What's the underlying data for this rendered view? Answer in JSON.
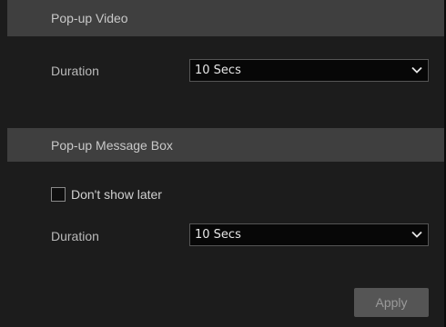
{
  "popup_video": {
    "title": "Pop-up Video",
    "duration_label": "Duration",
    "duration_value": "10 Secs"
  },
  "popup_message_box": {
    "title": "Pop-up Message Box",
    "dont_show_later_label": "Don't show later",
    "dont_show_later_checked": false,
    "duration_label": "Duration",
    "duration_value": "10 Secs"
  },
  "actions": {
    "apply_label": "Apply"
  },
  "icons": {
    "dropdown": "chevron-down-icon"
  },
  "colors": {
    "background": "#1c1c1c",
    "section_header": "#3f3f3f",
    "select_background": "#070707",
    "button_background": "#555555"
  }
}
